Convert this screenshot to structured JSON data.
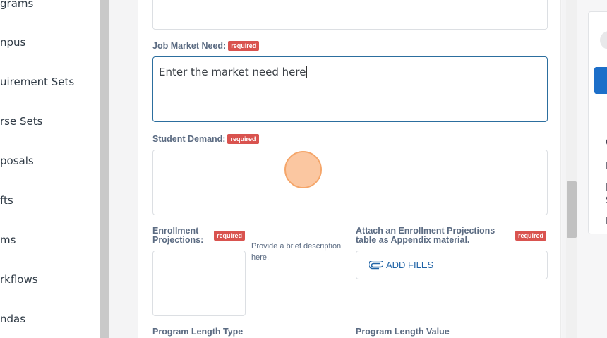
{
  "sidebar": {
    "items": [
      "grams",
      "npus",
      "uirement Sets",
      "rse Sets",
      "posals",
      "fts",
      "ms",
      "rkflows",
      "ndas"
    ]
  },
  "form": {
    "top_field_value": "",
    "job_market_need": {
      "label": "Job Market Need:",
      "badge": "required",
      "value": "Enter the market need here"
    },
    "student_demand": {
      "label": "Student Demand:",
      "badge": "required",
      "value": ""
    },
    "enrollment_projections": {
      "label": "Enrollment Projections:",
      "badge": "required",
      "hint": "Provide a brief description here."
    },
    "attach_enrollment": {
      "label": "Attach an Enrollment Projections table as Appendix material.",
      "badge": "required",
      "add_files_label": "ADD FILES"
    },
    "program_length_type": {
      "label": "Program Length Type"
    },
    "program_length_value": {
      "label": "Program Length Value"
    }
  },
  "side_panel": {
    "chars": [
      "C",
      "I",
      "I",
      "S",
      "I"
    ]
  },
  "colors": {
    "required_badge": "#d9534f",
    "focus_border": "#2c6e9e",
    "link_blue": "#1f63a6",
    "panel_button": "#1d6fc9"
  }
}
